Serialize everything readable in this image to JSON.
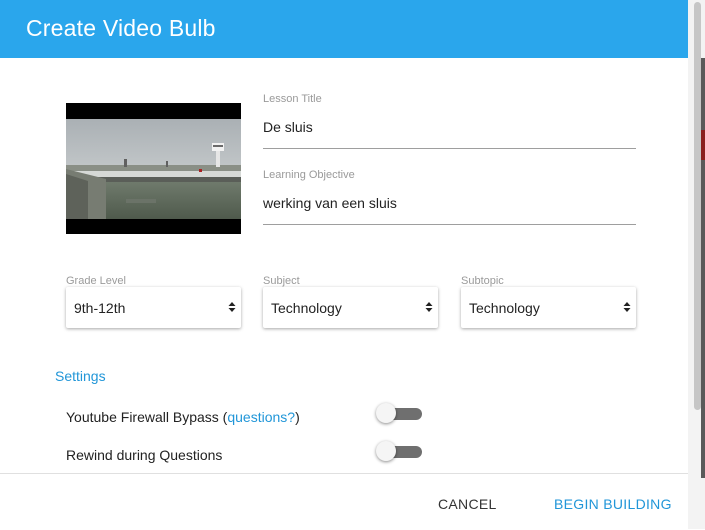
{
  "dialog": {
    "title": "Create Video Bulb"
  },
  "lesson_title": {
    "label": "Lesson Title",
    "value": "De sluis"
  },
  "learning_objective": {
    "label": "Learning Objective",
    "value": "werking van een sluis"
  },
  "grade_level": {
    "label": "Grade Level",
    "value": "9th-12th"
  },
  "subject": {
    "label": "Subject",
    "value": "Technology"
  },
  "subtopic": {
    "label": "Subtopic",
    "value": "Technology"
  },
  "settings": {
    "heading": "Settings",
    "youtube_bypass": {
      "label_prefix": "Youtube Firewall Bypass (",
      "link": "questions?",
      "label_suffix": ")",
      "enabled": false
    },
    "rewind": {
      "label": "Rewind during Questions",
      "enabled": false
    }
  },
  "footer": {
    "cancel_label": "CANCEL",
    "begin_label": "BEGIN BUILDING"
  },
  "colors": {
    "header": "#2aa6ec",
    "accent": "#2196d8"
  }
}
